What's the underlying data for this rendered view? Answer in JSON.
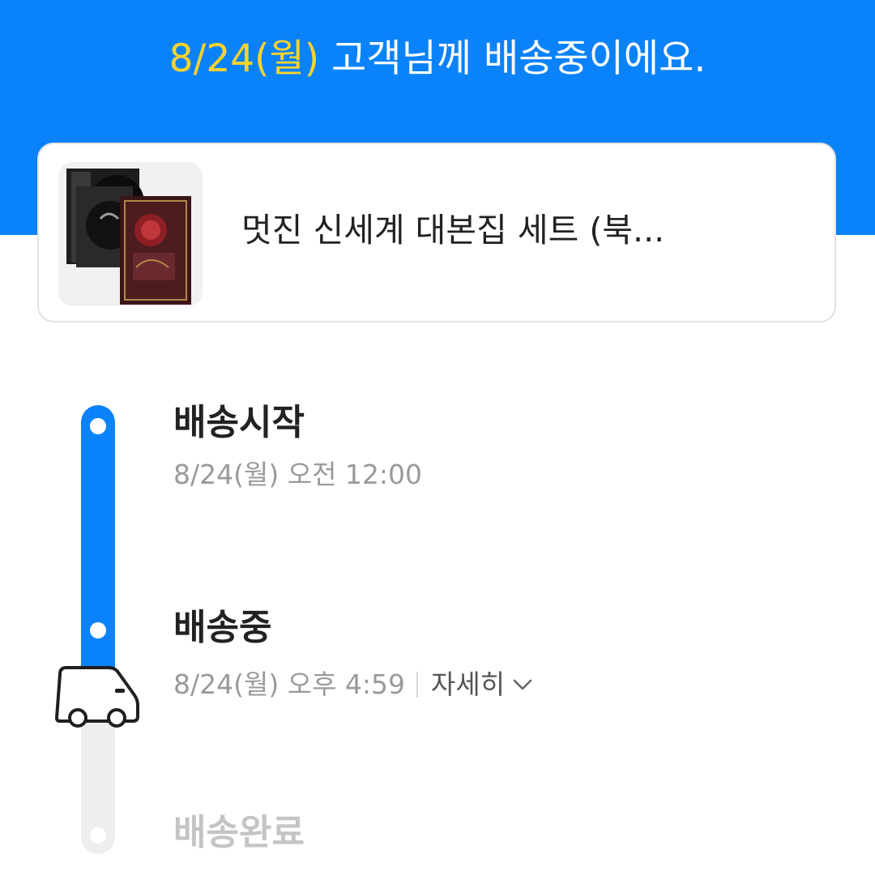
{
  "header": {
    "date_label": "8/24(월)",
    "message": " 고객님께 배송중이에요."
  },
  "product": {
    "name": "멋진 신세계 대본집 세트 (북..."
  },
  "timeline": {
    "progress_fraction": 0.67,
    "steps": [
      {
        "title": "배송시작",
        "time": "8/24(월) 오전 12:00",
        "status": "done"
      },
      {
        "title": "배송중",
        "time": "8/24(월) 오후 4:59",
        "detail_label": "자세히",
        "status": "current"
      },
      {
        "title": "배송완료",
        "status": "pending"
      }
    ]
  },
  "colors": {
    "brand_blue": "#0a82fa",
    "date_yellow": "#ffd32a",
    "pending_gray": "#c4c4c4"
  },
  "icons": [
    "truck-icon",
    "chevron-down-icon"
  ]
}
